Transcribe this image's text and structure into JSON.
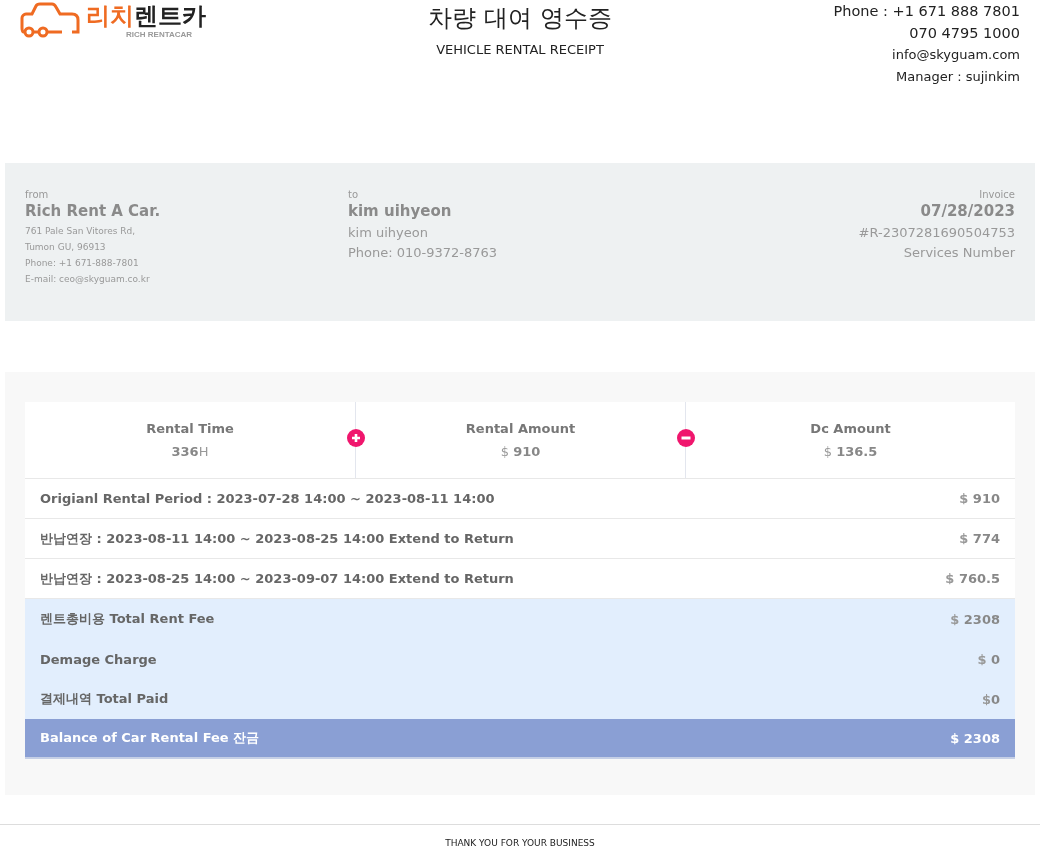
{
  "header": {
    "logo": {
      "brand_accent": "리치",
      "brand": "렌트카",
      "tagline": "RICH RENTACAR"
    },
    "title": "차량 대여 영수증",
    "subtitle": "VEHICLE RENTAL RECEIPT",
    "contact": [
      "Phone : +1 671 888 7801",
      "070 4795 1000",
      "info@skyguam.com",
      "Manager : sujinkim"
    ]
  },
  "parties": {
    "from": {
      "label": "from",
      "name": "Rich Rent A Car.",
      "lines": [
        "761 Pale San Vitores Rd,",
        "Tumon GU, 96913",
        "Phone: +1 671-888-7801",
        "E-mail: ceo@skyguam.co.kr"
      ]
    },
    "to": {
      "label": "to",
      "name": "kim uihyeon",
      "lines": [
        "kim uihyeon",
        "Phone: 010-9372-8763"
      ]
    },
    "invoice": {
      "label": "Invoice",
      "date": "07/28/2023",
      "number": "#R-2307281690504753",
      "number_label": "Services Number"
    }
  },
  "stats": [
    {
      "label": "Rental Time",
      "value": "**336**H",
      "kind": "plain"
    },
    {
      "label": "Rental Amount",
      "value": "$ **910**",
      "kind": "plus"
    },
    {
      "label": "Dc Amount",
      "value": "$ **136.5**",
      "kind": "minus"
    }
  ],
  "rows": [
    {
      "kind": "period",
      "label": "Origianl Rental Period : 2023-07-28 14:00 ~ 2023-08-11 14:00",
      "amount": "$ **910**"
    },
    {
      "kind": "period",
      "label": "반납연장 : 2023-08-11 14:00 ~ 2023-08-25 14:00 Extend to Return",
      "amount": "$ **774**"
    },
    {
      "kind": "period",
      "label": "반납연장 : 2023-08-25 14:00 ~ 2023-09-07 14:00 Extend to Return",
      "amount": "$ **760.5**"
    },
    {
      "kind": "total",
      "label": "렌트총비용 Total Rent Fee",
      "amount": "$ **2308**"
    },
    {
      "kind": "total",
      "label": "Demage Charge",
      "amount": "$ **0**"
    },
    {
      "kind": "total",
      "label": "결제내역 Total Paid",
      "amount": "$**0**"
    },
    {
      "kind": "balance",
      "label": "Balance of Car Rental Fee 잔금",
      "amount": "$ 2308"
    }
  ],
  "footer": "THANK YOU FOR YOUR BUSINESS"
}
